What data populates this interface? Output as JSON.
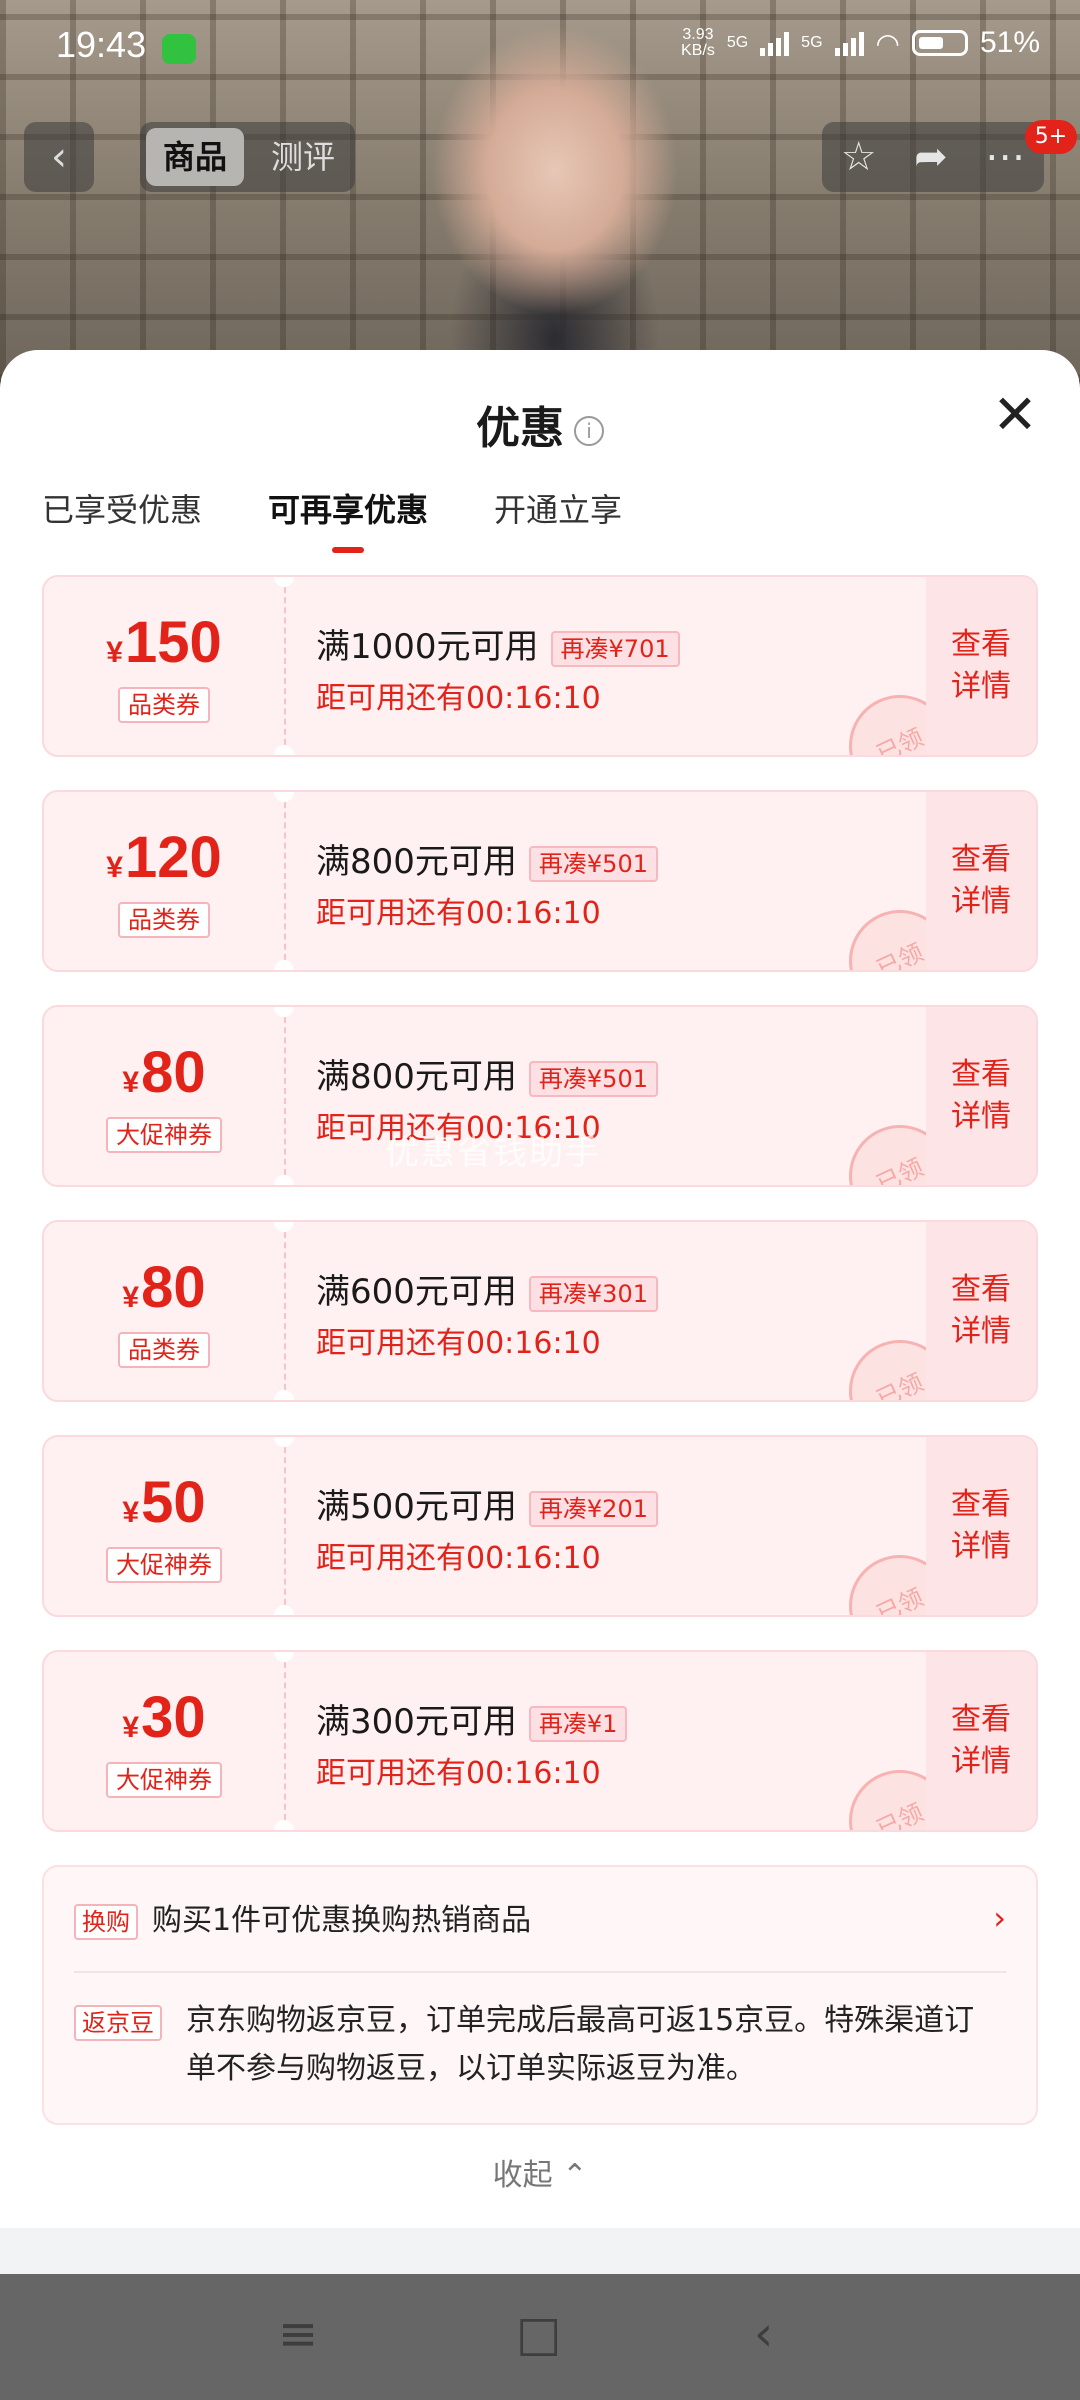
{
  "status_bar": {
    "time": "19:43",
    "app_icon": "wechat-icon",
    "network_speed": "3.93\nKB/s",
    "net1": "5G",
    "net2": "5G",
    "battery": "51%"
  },
  "top_nav": {
    "back_icon": "back-icon",
    "tabs": [
      {
        "label": "商品"
      },
      {
        "label": "测评"
      }
    ],
    "badge": "5+"
  },
  "sheet": {
    "title": "优惠",
    "tabs": [
      {
        "label": "已享受优惠",
        "active": false
      },
      {
        "label": "可再享优惠",
        "active": true
      },
      {
        "label": "开通立享",
        "active": false
      }
    ],
    "coupons": [
      {
        "currency": "¥",
        "amount": "150",
        "type": "品类券",
        "condition": "满1000元可用",
        "extra": "再凑¥701",
        "timer": "距可用还有00:16:10",
        "detail": "查看\n详情",
        "stamp": "已领"
      },
      {
        "currency": "¥",
        "amount": "120",
        "type": "品类券",
        "condition": "满800元可用",
        "extra": "再凑¥501",
        "timer": "距可用还有00:16:10",
        "detail": "查看\n详情",
        "stamp": "已领"
      },
      {
        "currency": "¥",
        "amount": "80",
        "type": "大促神券",
        "condition": "满800元可用",
        "extra": "再凑¥501",
        "timer": "距可用还有00:16:10",
        "detail": "查看\n详情",
        "stamp": "已领"
      },
      {
        "currency": "¥",
        "amount": "80",
        "type": "品类券",
        "condition": "满600元可用",
        "extra": "再凑¥301",
        "timer": "距可用还有00:16:10",
        "detail": "查看\n详情",
        "stamp": "已领"
      },
      {
        "currency": "¥",
        "amount": "50",
        "type": "大促神券",
        "condition": "满500元可用",
        "extra": "再凑¥201",
        "timer": "距可用还有00:16:10",
        "detail": "查看\n详情",
        "stamp": "已领"
      },
      {
        "currency": "¥",
        "amount": "30",
        "type": "大促神券",
        "condition": "满300元可用",
        "extra": "再凑¥1",
        "timer": "距可用还有00:16:10",
        "detail": "查看\n详情",
        "stamp": "已领"
      }
    ],
    "watermark": "优惠省钱助手",
    "exchange": {
      "tag": "换购",
      "text": "购买1件可优惠换购热销商品"
    },
    "jd_beans": {
      "tag": "返京豆",
      "text": "京东购物返京豆，订单完成后最高可返15京豆。特殊渠道订单不参与购物返豆，以订单实际返豆为准。"
    },
    "collapse": "收起"
  },
  "colors": {
    "accent": "#e2231a",
    "coupon_bg": "#fff1f2"
  }
}
